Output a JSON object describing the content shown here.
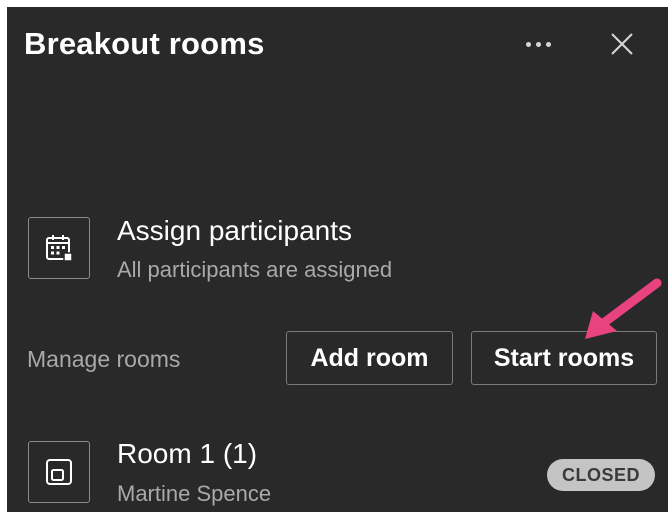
{
  "header": {
    "title": "Breakout rooms",
    "more_icon": "more-horizontal-icon",
    "close_icon": "close-icon"
  },
  "assign": {
    "icon": "calendar-grid-icon",
    "title": "Assign participants",
    "subtitle": "All participants are assigned"
  },
  "manage": {
    "label": "Manage rooms",
    "add_room_label": "Add room",
    "start_rooms_label": "Start rooms",
    "arrow_color": "#e8437f"
  },
  "rooms": [
    {
      "icon": "room-door-icon",
      "name": "Room 1 (1)",
      "participant": "Martine Spence",
      "status": "CLOSED"
    }
  ],
  "colors": {
    "panel_bg": "#292929",
    "text_primary": "#ffffff",
    "text_secondary": "#a9a9a9",
    "badge_bg": "#c4c4c4"
  }
}
